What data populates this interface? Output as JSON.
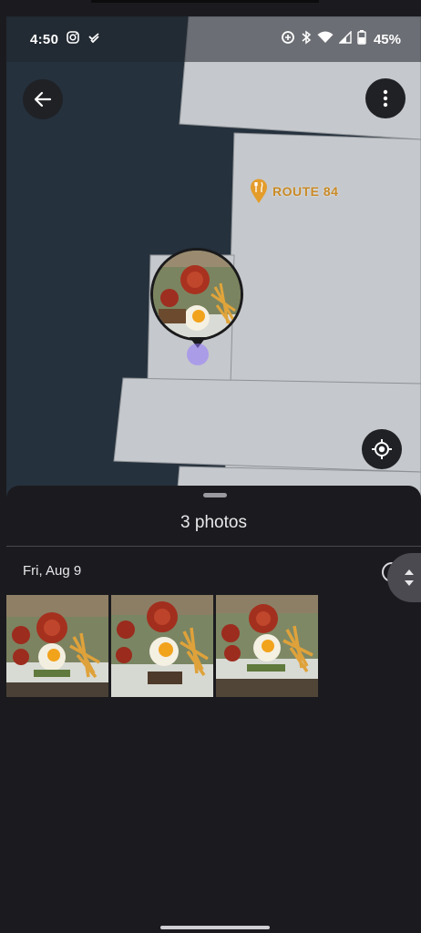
{
  "status_bar": {
    "time": "4:50",
    "battery": "45%"
  },
  "map": {
    "poi_label": "ROUTE 84",
    "colors": {
      "water": "#25313d",
      "land": "#c5c8cc",
      "poi": "#e49c2b"
    }
  },
  "sheet": {
    "title": "3 photos",
    "date": "Fri, Aug 9",
    "photos": [
      "food-photo",
      "food-photo",
      "food-photo"
    ]
  },
  "icons": {
    "back": "arrow-left-icon",
    "more": "more-vert-icon",
    "locate": "my-location-icon",
    "restaurant": "fork-knife-icon",
    "scroll": "up-down-arrows-icon"
  }
}
